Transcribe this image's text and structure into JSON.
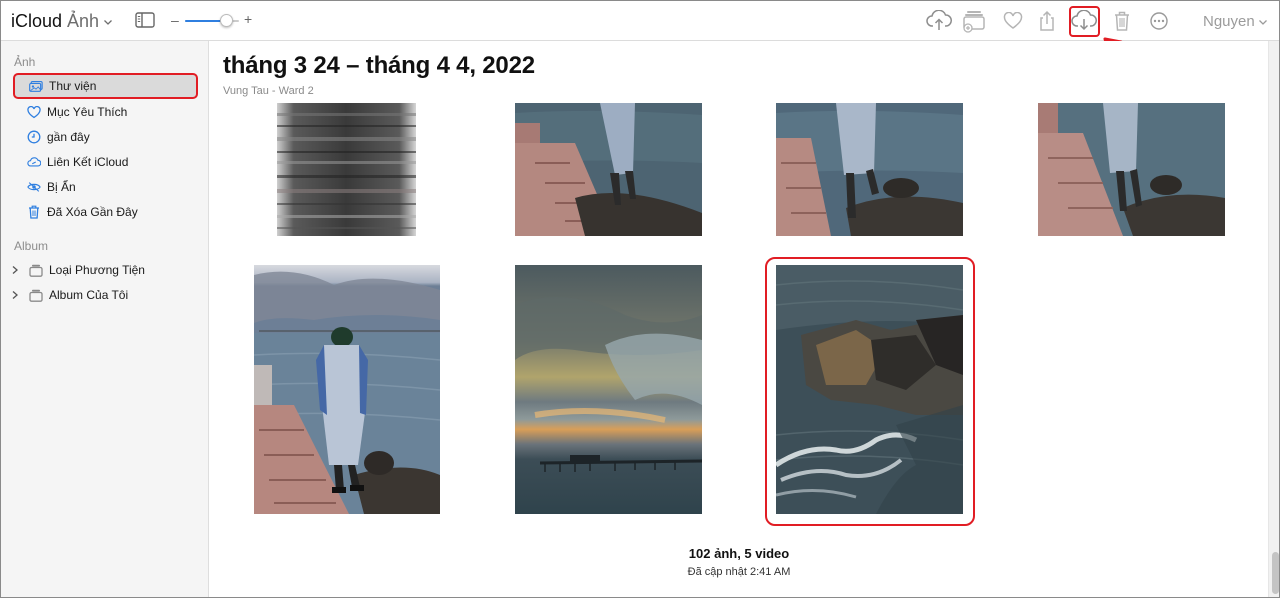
{
  "header": {
    "brand": "iCloud",
    "app_name": "Ảnh",
    "user_name": "Nguyen",
    "toolbar_icons": [
      "upload-icon",
      "add-to-album-icon",
      "heart-icon",
      "share-icon",
      "download-icon",
      "trash-icon",
      "more-icon"
    ]
  },
  "sidebar": {
    "section_photos": "Ảnh",
    "items": [
      {
        "label": "Thư viện",
        "icon": "library-icon"
      },
      {
        "label": "Mục Yêu Thích",
        "icon": "heart-icon"
      },
      {
        "label": "gần đây",
        "icon": "clock-icon"
      },
      {
        "label": "Liên Kết iCloud",
        "icon": "cloud-link-icon"
      },
      {
        "label": "Bị Ẩn",
        "icon": "eye-hidden-icon"
      },
      {
        "label": "Đã Xóa Gần Đây",
        "icon": "trash-icon"
      }
    ],
    "section_album": "Album",
    "folders": [
      {
        "label": "Loại Phương Tiện",
        "icon": "folder-icon"
      },
      {
        "label": "Album Của Tôi",
        "icon": "folder-icon"
      }
    ]
  },
  "main": {
    "title": "tháng 3 24 – tháng 4 4, 2022",
    "subtitle": "Vung Tau - Ward 2",
    "footer_count": "102 ảnh, 5 video",
    "footer_updated": "Đã cập nhật 2:41 AM"
  },
  "colors": {
    "accent": "#2f7fe0",
    "highlight": "#e11d24"
  }
}
